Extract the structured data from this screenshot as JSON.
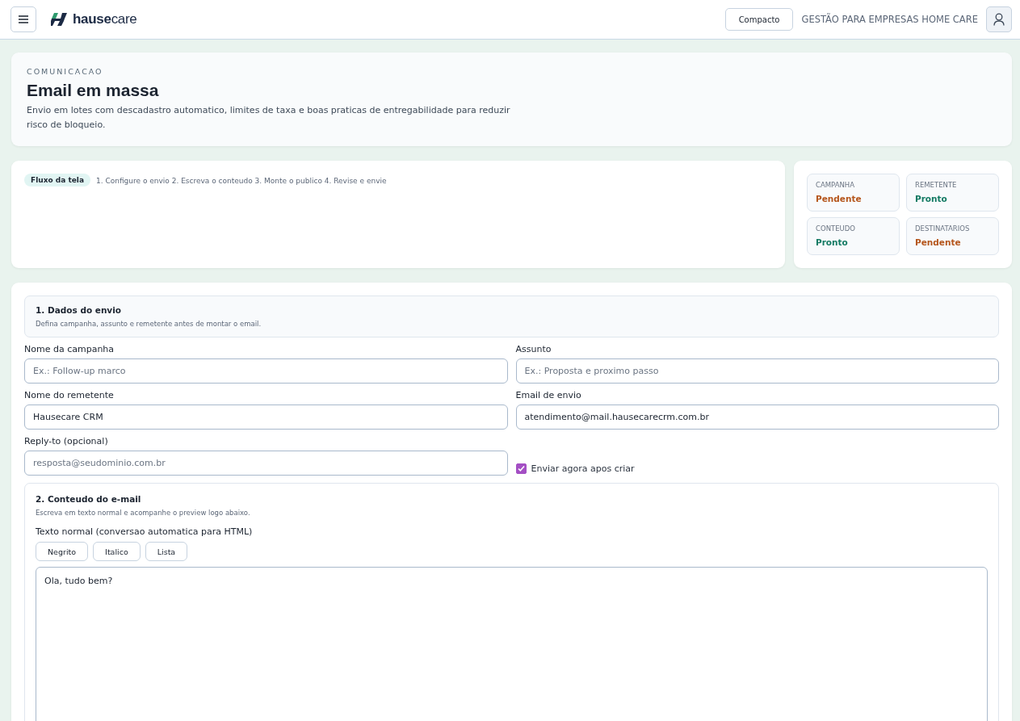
{
  "header": {
    "logo": "**hause**care",
    "compact_button": "Compacto",
    "tagline": "GESTÃO PARA EMPRESAS HOME CARE"
  },
  "intro": {
    "eyebrow": "COMUNICACAO",
    "title": "Email em massa",
    "description": "Envio em lotes com descadastro automatico, limites de taxa e boas praticas de entregabilidade para reduzir risco de bloqueio."
  },
  "flow": {
    "badge": "Fluxo da tela",
    "steps": "1. Configure o envio 2. Escreva o conteudo 3. Monte o publico 4. Revise e envie"
  },
  "status_cards": [
    {
      "label": "CAMPANHA",
      "value": "Pendente",
      "kind": "pending"
    },
    {
      "label": "REMETENTE",
      "value": "Pronto",
      "kind": "ready"
    },
    {
      "label": "CONTEUDO",
      "value": "Pronto",
      "kind": "ready"
    },
    {
      "label": "DESTINATARIOS",
      "value": "Pendente",
      "kind": "pending"
    }
  ],
  "section1": {
    "title": "1. Dados do envio",
    "subtitle": "Defina campanha, assunto e remetente antes de montar o email.",
    "fields": [
      {
        "label": "Nome da campanha",
        "placeholder": "Ex.: Follow-up marco"
      },
      {
        "label": "Assunto",
        "placeholder": "Ex.: Proposta e proximo passo"
      },
      {
        "label": "Nome do remetente",
        "value": "Hausecare CRM"
      },
      {
        "label": "Email de envio",
        "value": "atendimento@mail.hausecarecrm.com.br"
      },
      {
        "label": "Reply-to (opcional)",
        "placeholder": "resposta@seudominio.com.br"
      }
    ],
    "send_now": {
      "label": "Enviar agora apos criar",
      "checked": true
    }
  },
  "section2": {
    "title": "2. Conteudo do e-mail",
    "subtitle": "Escreva em texto normal e acompanhe o preview logo abaixo.",
    "editor_label": "Texto normal (conversao automatica para HTML)",
    "format_buttons": [
      "Negrito",
      "Italico",
      "Lista"
    ],
    "body": "Ola, tudo bem?"
  }
}
